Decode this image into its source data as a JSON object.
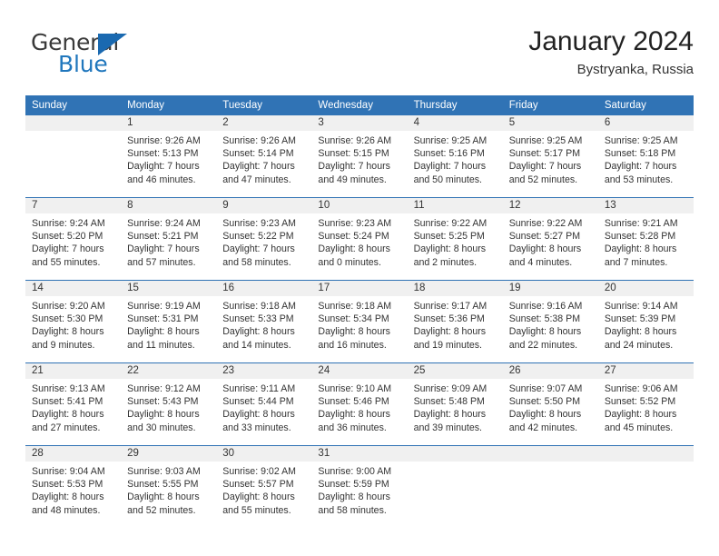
{
  "brand": {
    "name_top": "General",
    "name_bottom": "Blue",
    "accent_color": "#2077bd",
    "triangle_color": "#1a69b0"
  },
  "header": {
    "title": "January 2024",
    "subtitle": "Bystryanka, Russia"
  },
  "theme": {
    "header_blue": "#3073b5",
    "row_divider_blue": "#2f72b4",
    "daynum_band": "#f0f0f0",
    "text": "#333333"
  },
  "weekdays": [
    "Sunday",
    "Monday",
    "Tuesday",
    "Wednesday",
    "Thursday",
    "Friday",
    "Saturday"
  ],
  "labels": {
    "sunrise_prefix": "Sunrise:",
    "sunset_prefix": "Sunset:",
    "daylight_prefix": "Daylight:"
  },
  "weeks": [
    [
      {
        "day": "",
        "blank": true,
        "line1": "",
        "line2": "",
        "line3": "",
        "line4": ""
      },
      {
        "day": "1",
        "line1": "Sunrise: 9:26 AM",
        "line2": "Sunset: 5:13 PM",
        "line3": "Daylight: 7 hours",
        "line4": "and 46 minutes."
      },
      {
        "day": "2",
        "line1": "Sunrise: 9:26 AM",
        "line2": "Sunset: 5:14 PM",
        "line3": "Daylight: 7 hours",
        "line4": "and 47 minutes."
      },
      {
        "day": "3",
        "line1": "Sunrise: 9:26 AM",
        "line2": "Sunset: 5:15 PM",
        "line3": "Daylight: 7 hours",
        "line4": "and 49 minutes."
      },
      {
        "day": "4",
        "line1": "Sunrise: 9:25 AM",
        "line2": "Sunset: 5:16 PM",
        "line3": "Daylight: 7 hours",
        "line4": "and 50 minutes."
      },
      {
        "day": "5",
        "line1": "Sunrise: 9:25 AM",
        "line2": "Sunset: 5:17 PM",
        "line3": "Daylight: 7 hours",
        "line4": "and 52 minutes."
      },
      {
        "day": "6",
        "line1": "Sunrise: 9:25 AM",
        "line2": "Sunset: 5:18 PM",
        "line3": "Daylight: 7 hours",
        "line4": "and 53 minutes."
      }
    ],
    [
      {
        "day": "7",
        "line1": "Sunrise: 9:24 AM",
        "line2": "Sunset: 5:20 PM",
        "line3": "Daylight: 7 hours",
        "line4": "and 55 minutes."
      },
      {
        "day": "8",
        "line1": "Sunrise: 9:24 AM",
        "line2": "Sunset: 5:21 PM",
        "line3": "Daylight: 7 hours",
        "line4": "and 57 minutes."
      },
      {
        "day": "9",
        "line1": "Sunrise: 9:23 AM",
        "line2": "Sunset: 5:22 PM",
        "line3": "Daylight: 7 hours",
        "line4": "and 58 minutes."
      },
      {
        "day": "10",
        "line1": "Sunrise: 9:23 AM",
        "line2": "Sunset: 5:24 PM",
        "line3": "Daylight: 8 hours",
        "line4": "and 0 minutes."
      },
      {
        "day": "11",
        "line1": "Sunrise: 9:22 AM",
        "line2": "Sunset: 5:25 PM",
        "line3": "Daylight: 8 hours",
        "line4": "and 2 minutes."
      },
      {
        "day": "12",
        "line1": "Sunrise: 9:22 AM",
        "line2": "Sunset: 5:27 PM",
        "line3": "Daylight: 8 hours",
        "line4": "and 4 minutes."
      },
      {
        "day": "13",
        "line1": "Sunrise: 9:21 AM",
        "line2": "Sunset: 5:28 PM",
        "line3": "Daylight: 8 hours",
        "line4": "and 7 minutes."
      }
    ],
    [
      {
        "day": "14",
        "line1": "Sunrise: 9:20 AM",
        "line2": "Sunset: 5:30 PM",
        "line3": "Daylight: 8 hours",
        "line4": "and 9 minutes."
      },
      {
        "day": "15",
        "line1": "Sunrise: 9:19 AM",
        "line2": "Sunset: 5:31 PM",
        "line3": "Daylight: 8 hours",
        "line4": "and 11 minutes."
      },
      {
        "day": "16",
        "line1": "Sunrise: 9:18 AM",
        "line2": "Sunset: 5:33 PM",
        "line3": "Daylight: 8 hours",
        "line4": "and 14 minutes."
      },
      {
        "day": "17",
        "line1": "Sunrise: 9:18 AM",
        "line2": "Sunset: 5:34 PM",
        "line3": "Daylight: 8 hours",
        "line4": "and 16 minutes."
      },
      {
        "day": "18",
        "line1": "Sunrise: 9:17 AM",
        "line2": "Sunset: 5:36 PM",
        "line3": "Daylight: 8 hours",
        "line4": "and 19 minutes."
      },
      {
        "day": "19",
        "line1": "Sunrise: 9:16 AM",
        "line2": "Sunset: 5:38 PM",
        "line3": "Daylight: 8 hours",
        "line4": "and 22 minutes."
      },
      {
        "day": "20",
        "line1": "Sunrise: 9:14 AM",
        "line2": "Sunset: 5:39 PM",
        "line3": "Daylight: 8 hours",
        "line4": "and 24 minutes."
      }
    ],
    [
      {
        "day": "21",
        "line1": "Sunrise: 9:13 AM",
        "line2": "Sunset: 5:41 PM",
        "line3": "Daylight: 8 hours",
        "line4": "and 27 minutes."
      },
      {
        "day": "22",
        "line1": "Sunrise: 9:12 AM",
        "line2": "Sunset: 5:43 PM",
        "line3": "Daylight: 8 hours",
        "line4": "and 30 minutes."
      },
      {
        "day": "23",
        "line1": "Sunrise: 9:11 AM",
        "line2": "Sunset: 5:44 PM",
        "line3": "Daylight: 8 hours",
        "line4": "and 33 minutes."
      },
      {
        "day": "24",
        "line1": "Sunrise: 9:10 AM",
        "line2": "Sunset: 5:46 PM",
        "line3": "Daylight: 8 hours",
        "line4": "and 36 minutes."
      },
      {
        "day": "25",
        "line1": "Sunrise: 9:09 AM",
        "line2": "Sunset: 5:48 PM",
        "line3": "Daylight: 8 hours",
        "line4": "and 39 minutes."
      },
      {
        "day": "26",
        "line1": "Sunrise: 9:07 AM",
        "line2": "Sunset: 5:50 PM",
        "line3": "Daylight: 8 hours",
        "line4": "and 42 minutes."
      },
      {
        "day": "27",
        "line1": "Sunrise: 9:06 AM",
        "line2": "Sunset: 5:52 PM",
        "line3": "Daylight: 8 hours",
        "line4": "and 45 minutes."
      }
    ],
    [
      {
        "day": "28",
        "line1": "Sunrise: 9:04 AM",
        "line2": "Sunset: 5:53 PM",
        "line3": "Daylight: 8 hours",
        "line4": "and 48 minutes."
      },
      {
        "day": "29",
        "line1": "Sunrise: 9:03 AM",
        "line2": "Sunset: 5:55 PM",
        "line3": "Daylight: 8 hours",
        "line4": "and 52 minutes."
      },
      {
        "day": "30",
        "line1": "Sunrise: 9:02 AM",
        "line2": "Sunset: 5:57 PM",
        "line3": "Daylight: 8 hours",
        "line4": "and 55 minutes."
      },
      {
        "day": "31",
        "line1": "Sunrise: 9:00 AM",
        "line2": "Sunset: 5:59 PM",
        "line3": "Daylight: 8 hours",
        "line4": "and 58 minutes."
      },
      {
        "day": "",
        "blank": true,
        "line1": "",
        "line2": "",
        "line3": "",
        "line4": ""
      },
      {
        "day": "",
        "blank": true,
        "line1": "",
        "line2": "",
        "line3": "",
        "line4": ""
      },
      {
        "day": "",
        "blank": true,
        "line1": "",
        "line2": "",
        "line3": "",
        "line4": ""
      }
    ]
  ]
}
